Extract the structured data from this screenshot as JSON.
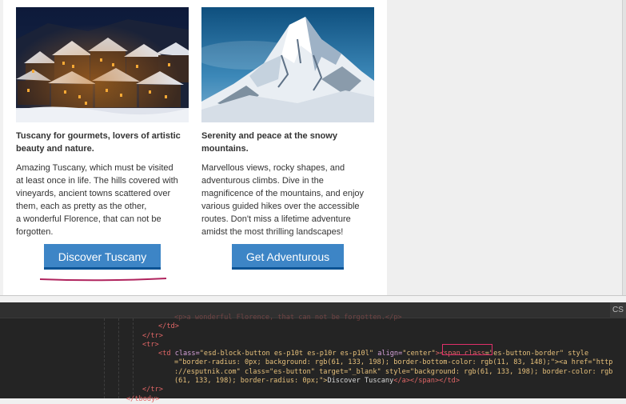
{
  "columns": [
    {
      "heading": "Tuscany for gourmets, lovers of artistic beauty and nature.",
      "body_lines": [
        "Amazing Tuscany, which must be visited",
        "at least once in life. The hills covered with",
        "vineyards, ancient towns scattered over",
        "them, each as pretty as the other,",
        "a wonderful Florence, that can not be",
        "forgotten."
      ],
      "button": "Discover Tuscany",
      "image": "snowy-village-night"
    },
    {
      "heading": "Serenity and peace at the snowy mountains.",
      "body_lines": [
        "Marvellous views, rocky shapes, and",
        "adventurous climbs. Dive in the",
        "magnificence of the mountains, and enjoy",
        "various guided hikes over the accessible",
        "routes. Don't miss a lifetime adventure",
        "amidst the  most thrilling landscapes!"
      ],
      "button": "Get Adventurous",
      "image": "snowy-mountain-peak"
    }
  ],
  "devtools": {
    "tab_label": "CS",
    "line0": "<p>a wonderful Florence, that can not be forgotten.</p>",
    "line1": "</td>",
    "line2": "</tr>",
    "line3": "<tr>",
    "line4_pre": "<td ",
    "line4_attr": "class=",
    "line4_class": "\"esd-block-button es-p10t es-p10r es-p10l\"",
    "line4_align": " align=",
    "line4_alignval": "\"center\"",
    "line4_gt": ">",
    "line4_span": "<span class",
    "line4_span2": "=\"es-button-border\" style",
    "line5": "=\"border-radius: 0px; background: rgb(61, 133, 198); border-bottom-color: rgb(11, 83, 148);\"><a href=\"http",
    "line6": "://esputnik.com\" class=\"es-button\" target=\"_blank\" style=\"background: rgb(61, 133, 198); border-color: rgb",
    "line7_pre": "(61, 133, 198); border-radius: 0px;\">",
    "line7_txt": "Discover Tuscany",
    "line7_post": "</a></span></td>",
    "line8": "</tr>",
    "line9": "</tbody>"
  },
  "colors": {
    "button": "#3d85c6",
    "button_border": "#0b5394",
    "highlight": "#e0306a"
  }
}
